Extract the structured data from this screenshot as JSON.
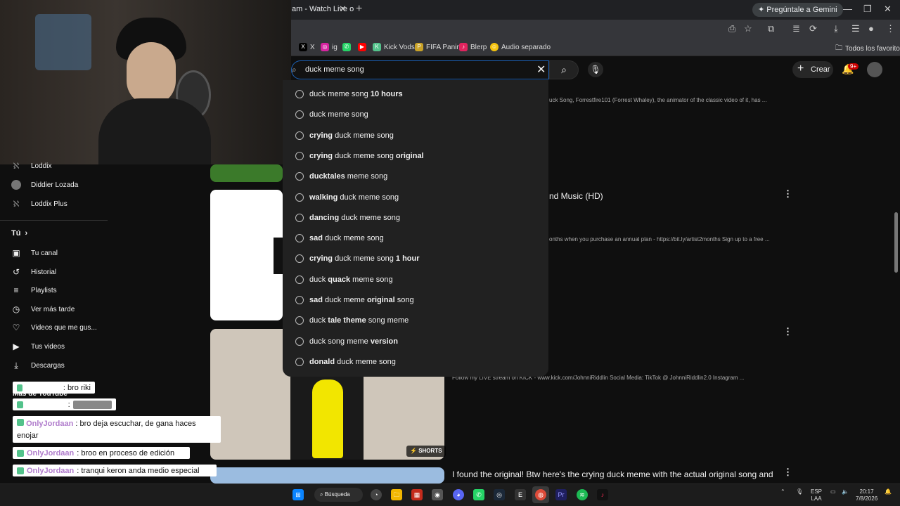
{
  "browser": {
    "tab_title": "am - Watch Live o",
    "tab_close": "✕",
    "new_tab": "+",
    "gemini_label": "Pregúntale a Gemini",
    "window_controls": [
      "—",
      "❐",
      "✕"
    ],
    "bookmarks": [
      {
        "label": "X",
        "color": "#000000",
        "icon": "x-icon"
      },
      {
        "label": "ig",
        "color": "#d6249f",
        "icon": "instagram-icon"
      },
      {
        "label": "",
        "color": "#25d366",
        "icon": "whatsapp-icon"
      },
      {
        "label": "",
        "color": "#ff0000",
        "icon": "youtube-icon"
      },
      {
        "label": "Kick Vods",
        "color": "#53c28b",
        "icon": "kick-icon"
      },
      {
        "label": "FIFA Panini",
        "color": "#c9a227",
        "icon": "panini-icon"
      },
      {
        "label": "Blerp",
        "color": "#e0245e",
        "icon": "blerp-icon"
      },
      {
        "label": "Audio separado",
        "color": "#f4c20d",
        "icon": "audio-icon"
      }
    ],
    "all_bookmarks": "Todos los favoritos"
  },
  "youtube": {
    "search_query": "duck meme song",
    "create_label": "Crear",
    "notification_count": "9+",
    "suggestions": [
      {
        "pre": "duck meme song ",
        "bold": "10 hours",
        "post": ""
      },
      {
        "pre": "duck meme song",
        "bold": "",
        "post": ""
      },
      {
        "pre": "",
        "bold": "crying",
        "post": " duck meme song"
      },
      {
        "pre": "",
        "bold": "crying",
        "post": " duck meme song ",
        "bold2": "original"
      },
      {
        "pre": "",
        "bold": "ducktales",
        "post": " meme song"
      },
      {
        "pre": "",
        "bold": "walking",
        "post": " duck meme song"
      },
      {
        "pre": "",
        "bold": "dancing",
        "post": " duck meme song"
      },
      {
        "pre": "",
        "bold": "sad",
        "post": " duck meme song"
      },
      {
        "pre": "",
        "bold": "crying",
        "post": " duck meme song ",
        "bold2": "1 hour"
      },
      {
        "pre": "duck ",
        "bold": "quack",
        "post": " meme song"
      },
      {
        "pre": "",
        "bold": "sad",
        "post": " duck meme ",
        "bold2": "original",
        "post2": " song"
      },
      {
        "pre": "duck ",
        "bold": "tale theme",
        "post": " song meme"
      },
      {
        "pre": "duck song meme ",
        "bold": "version",
        "post": ""
      },
      {
        "pre": "",
        "bold": "donald",
        "post": " duck meme song"
      }
    ],
    "sidebar": {
      "subs": [
        {
          "label": "Loddix",
          "icon": "kick-icon"
        },
        {
          "label": "Diddier Lozada",
          "icon": "avatar-icon"
        },
        {
          "label": "Loddix Plus",
          "icon": "kick-icon"
        }
      ],
      "you_header": "Tú",
      "you_items": [
        {
          "label": "Tu canal",
          "icon": "channel-icon",
          "glyph": "▣"
        },
        {
          "label": "Historial",
          "icon": "history-icon",
          "glyph": "↺"
        },
        {
          "label": "Playlists",
          "icon": "playlist-icon",
          "glyph": "≡"
        },
        {
          "label": "Ver más tarde",
          "icon": "clock-icon",
          "glyph": "◷"
        },
        {
          "label": "Videos que me gus...",
          "icon": "like-icon",
          "glyph": "👍"
        },
        {
          "label": "Tus videos",
          "icon": "video-icon",
          "glyph": "▶"
        },
        {
          "label": "Descargas",
          "icon": "download-icon",
          "glyph": "⤓"
        }
      ],
      "more_label": "Más de YouTube"
    },
    "results": {
      "r1_desc": "uck Song, Forrestfire101 (Forrest Whaley), the animator of the classic video of it, has ...",
      "r2_title": "nd Music (HD)",
      "r2_desc": "onths when you purchase an annual plan - https://bit.ly/artist2months Sign up to a free ...",
      "r3_desc": "Follow my LIVE stream on KICK - www.kick.com/JohnniRiddlin Social Media: TikTok @ JohnniRiddlin2.0 Instagram ...",
      "shorts_badge": "SHORTS",
      "r4_title": "I found the original! Btw here's the crying duck meme with the actual original song and"
    }
  },
  "chat": [
    {
      "user": "",
      "text": ": bro riki"
    },
    {
      "user": "",
      "text": ":"
    },
    {
      "user": "OnlyJordaan",
      "text": ": bro deja escuchar, de gana haces enojar"
    },
    {
      "user": "OnlyJordaan",
      "text": ": broo en proceso de edición"
    },
    {
      "user": "OnlyJordaan",
      "text": ": tranqui keron anda medio especial"
    }
  ],
  "taskbar": {
    "search_label": "Búsqueda",
    "lang": "ESP",
    "lang2": "LAA",
    "time": "20:17",
    "date": "7/8/2026"
  }
}
